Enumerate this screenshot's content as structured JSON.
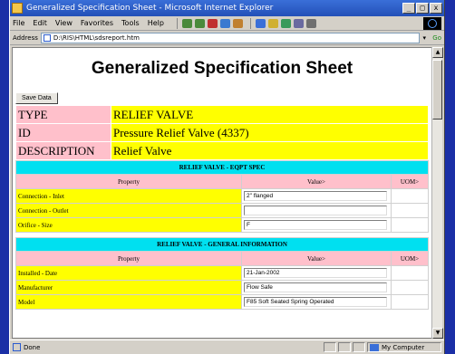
{
  "window": {
    "title": "Generalized Specification Sheet - Microsoft Internet Explorer",
    "min": "_",
    "max": "□",
    "close": "x"
  },
  "menu": {
    "items": [
      "File",
      "Edit",
      "View",
      "Favorites",
      "Tools",
      "Help"
    ]
  },
  "address": {
    "label": "Address",
    "value": "D:\\RIS\\HTML\\sdsreport.htm",
    "go": "Go"
  },
  "page": {
    "title": "Generalized Specification Sheet",
    "save_label": "Save Data",
    "header": [
      {
        "key": "TYPE",
        "value": "RELIEF VALVE"
      },
      {
        "key": "ID",
        "value": "Pressure Relief Valve (4337)"
      },
      {
        "key": "DESCRIPTION",
        "value": "Relief Valve"
      }
    ],
    "sections": [
      {
        "title": "RELIEF VALVE - EQPT SPEC",
        "col_property": "Property",
        "col_value": "Value>",
        "col_uom": "UOM>",
        "rows": [
          {
            "property": "Connection - Inlet",
            "value": "2\" flanged"
          },
          {
            "property": "Connection - Outlet",
            "value": ""
          },
          {
            "property": "Orifice - Size",
            "value": "F"
          }
        ]
      },
      {
        "title": "RELIEF VALVE - GENERAL INFORMATION",
        "col_property": "Property",
        "col_value": "Value>",
        "col_uom": "UOM>",
        "rows": [
          {
            "property": "Installed - Date",
            "value": "21-Jan-2002"
          },
          {
            "property": "Manufacturer",
            "value": "Flow Safe"
          },
          {
            "property": "Model",
            "value": "F85 Soft Seated Spring Operated"
          }
        ]
      }
    ]
  },
  "status": {
    "text": "Done",
    "zone": "My Computer"
  },
  "colors": {
    "key_bg": "#ffc0cb",
    "value_bg": "#ffff00",
    "section_bg": "#00e0f0",
    "desktop": "#1b2fa6"
  }
}
